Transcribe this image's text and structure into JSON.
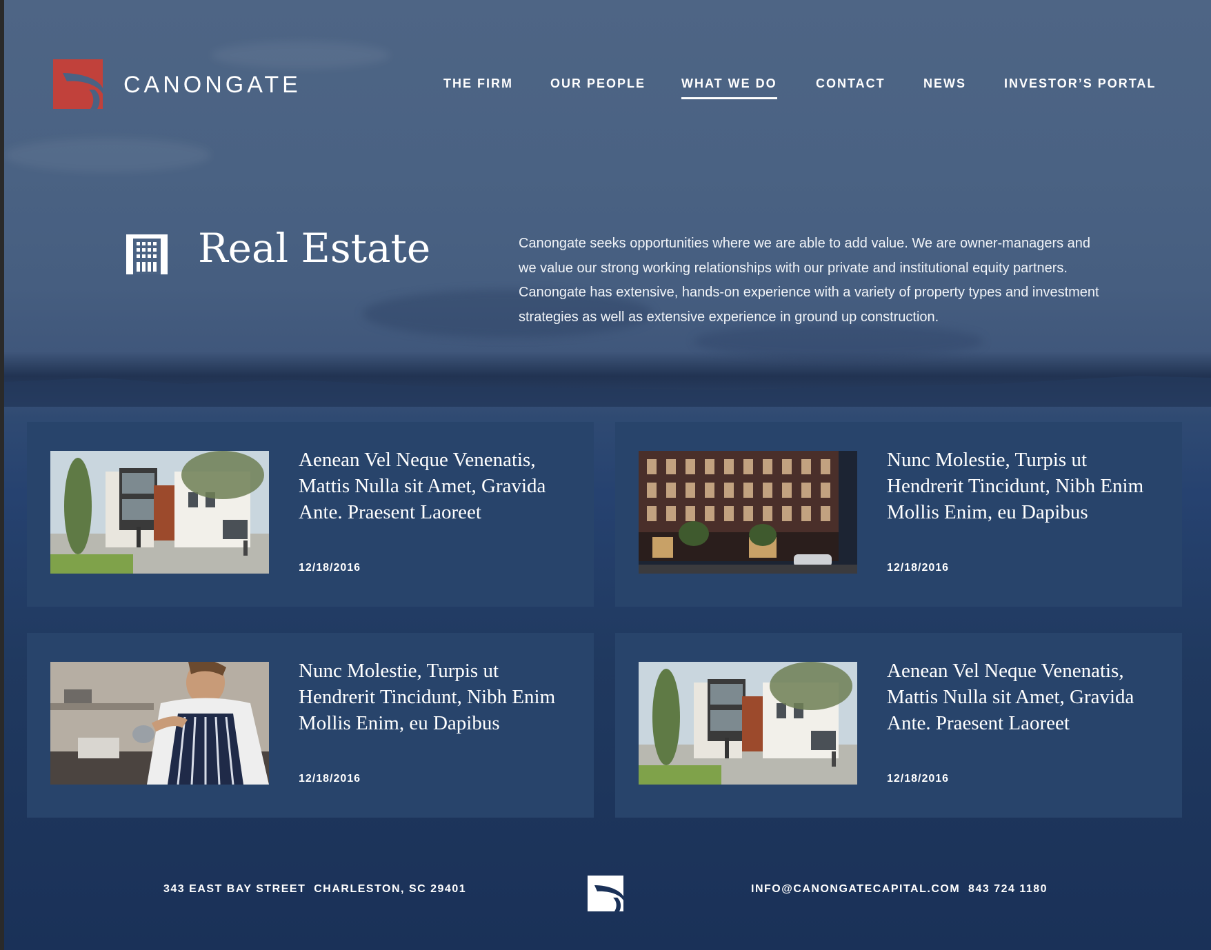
{
  "brand": {
    "name": "CANONGATE",
    "logo_color": "#c1413b"
  },
  "nav": {
    "items": [
      {
        "label": "THE FIRM",
        "active": false
      },
      {
        "label": "OUR PEOPLE",
        "active": false
      },
      {
        "label": "WHAT WE DO",
        "active": true
      },
      {
        "label": "CONTACT",
        "active": false
      },
      {
        "label": "NEWS",
        "active": false
      },
      {
        "label": "INVESTOR’S PORTAL",
        "active": false
      }
    ]
  },
  "hero": {
    "icon": "building-icon",
    "title": "Real Estate",
    "description": "Canongate seeks opportunities where we are able to add value. We are owner-managers and we value our strong working relationships with our private and institutional equity partners. Canongate has extensive, hands-on experience with a variety of property types and investment strategies as well as extensive experience in ground up construction."
  },
  "cards": [
    {
      "image": "townhouse-rendering",
      "title": "Aenean Vel Neque Venenatis, Mattis Nulla sit Amet, Gravida Ante. Praesent Laoreet",
      "date": "12/18/2016"
    },
    {
      "image": "brick-building-night",
      "title": "Nunc Molestie, Turpis ut Hendrerit Tincidunt, Nibh Enim Mollis Enim, eu Dapibus",
      "date": "12/18/2016"
    },
    {
      "image": "chef-pouring",
      "title": "Nunc Molestie, Turpis ut Hendrerit Tincidunt, Nibh Enim Mollis Enim, eu Dapibus",
      "date": "12/18/2016"
    },
    {
      "image": "townhouse-rendering",
      "title": "Aenean Vel Neque Venenatis, Mattis Nulla sit Amet, Gravida Ante. Praesent Laoreet",
      "date": "12/18/2016"
    }
  ],
  "footer": {
    "address": "343 EAST BAY STREET  CHARLESTON, SC 29401",
    "contact": "INFO@CANONGATECAPITAL.COM  843 724 1180"
  },
  "colors": {
    "card_bg": "#28446b",
    "background_top": "#4e6585",
    "background_bottom": "#1a3158"
  }
}
